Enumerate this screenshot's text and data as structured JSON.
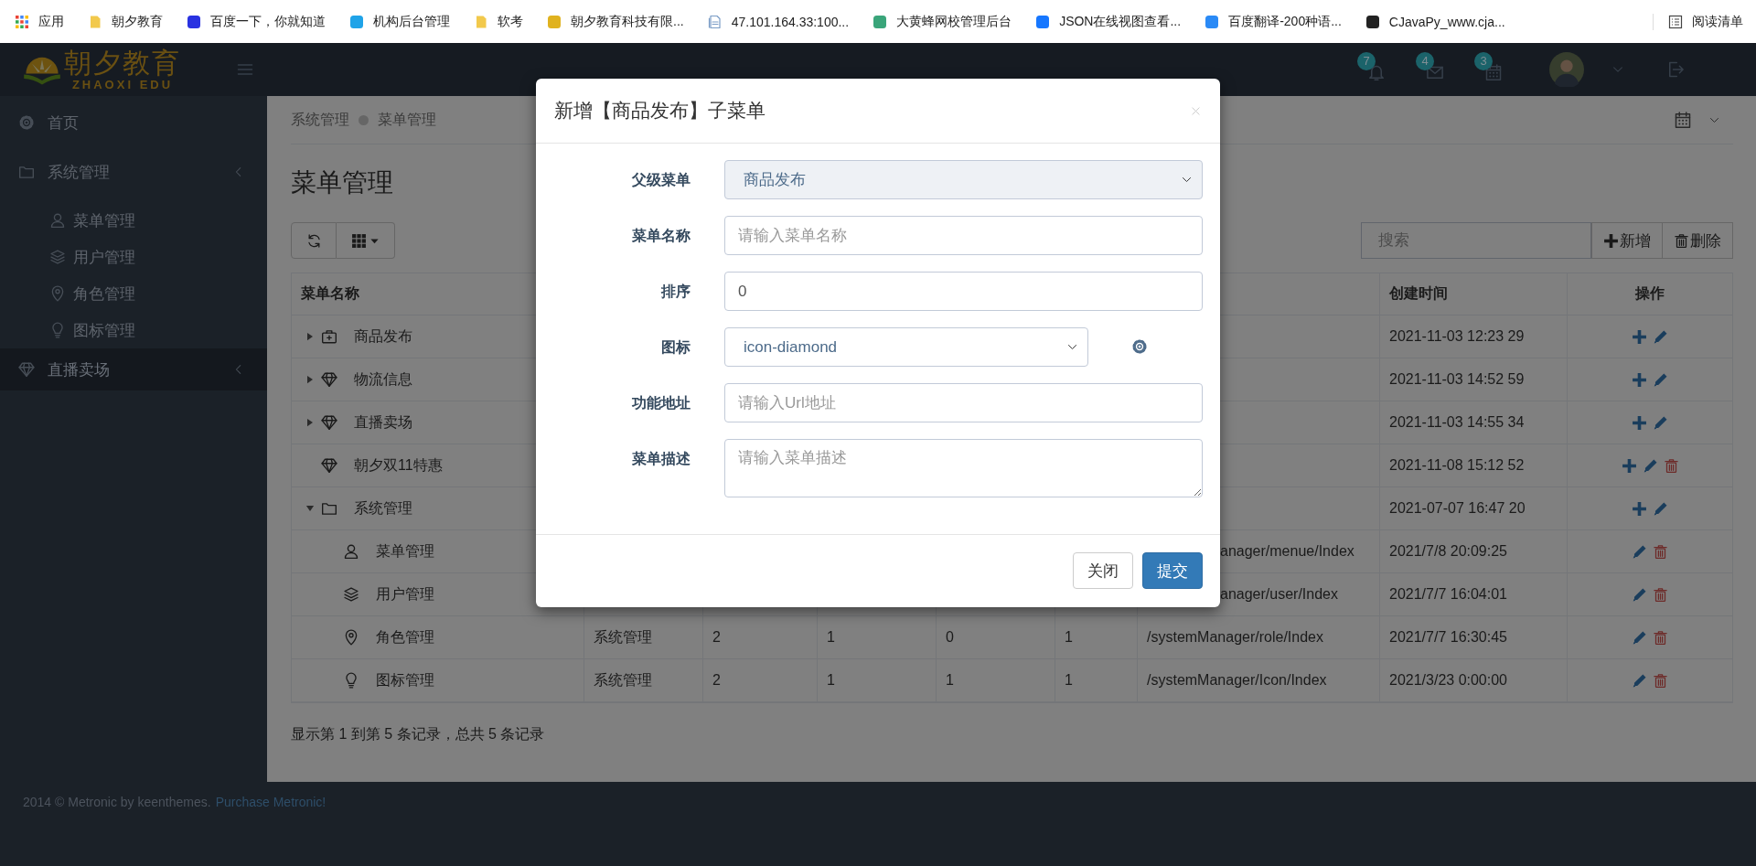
{
  "bookmarks": {
    "items": [
      {
        "kind": "apps",
        "label": "应用"
      },
      {
        "kind": "folder",
        "label": "朝夕教育"
      },
      {
        "kind": "site",
        "color": "#2932e1",
        "label": "百度一下，你就知道"
      },
      {
        "kind": "site",
        "color": "#1fa3e8",
        "label": "机构后台管理"
      },
      {
        "kind": "folder",
        "label": "软考"
      },
      {
        "kind": "site",
        "color": "#e0b21f",
        "label": "朝夕教育科技有限..."
      },
      {
        "kind": "page",
        "label": "47.101.164.33:100..."
      },
      {
        "kind": "site",
        "color": "#3aa57a",
        "label": "大黄蜂网校管理后台"
      },
      {
        "kind": "site",
        "color": "#1677ff",
        "label": "JSON在线视图查看..."
      },
      {
        "kind": "site",
        "color": "#2a8af6",
        "label": "百度翻译-200种语..."
      },
      {
        "kind": "site",
        "color": "#222222",
        "label": "CJavaPy_www.cja..."
      }
    ],
    "reading_list": "阅读清单"
  },
  "header": {
    "logo": {
      "name": "朝夕教育",
      "subtitle": "ZHAOXI EDU"
    },
    "notifications": [
      {
        "kind": "bell",
        "count": "7"
      },
      {
        "kind": "envelope",
        "count": "4"
      },
      {
        "kind": "calendar",
        "count": "3"
      }
    ]
  },
  "sidebar": {
    "items": [
      {
        "kind": "gear",
        "label": "首页",
        "selected": false
      },
      {
        "kind": "folder",
        "label": "系统管理",
        "selected": false,
        "submenu": true,
        "children": [
          {
            "kind": "user",
            "label": "菜单管理",
            "selected": false
          },
          {
            "kind": "layers",
            "label": "用户管理",
            "selected": false
          },
          {
            "kind": "pin",
            "label": "角色管理",
            "selected": false
          },
          {
            "kind": "bulb",
            "label": "图标管理",
            "selected": false
          }
        ]
      },
      {
        "kind": "diamond",
        "label": "直播卖场",
        "selected": true,
        "submenu": true
      }
    ]
  },
  "breadcrumb": [
    "系统管理",
    "菜单管理"
  ],
  "page_title": "菜单管理",
  "toolbar": {
    "search_placeholder": "搜索",
    "buttons": [
      {
        "kind": "add",
        "label": "新增"
      },
      {
        "kind": "delete",
        "label": "删除"
      }
    ]
  },
  "table": {
    "columns": [
      "菜单名称",
      "创建时间",
      "操作"
    ],
    "rows": [
      {
        "kind": "briefcase",
        "name": "商品发布",
        "expanded": false,
        "created": "2021-11-03 12:23 29",
        "actions": [
          {
            "kind": "add"
          },
          {
            "kind": "edit"
          }
        ]
      },
      {
        "kind": "diamond",
        "name": "物流信息",
        "expanded": false,
        "created": "2021-11-03 14:52 59",
        "actions": [
          {
            "kind": "add"
          },
          {
            "kind": "edit"
          }
        ]
      },
      {
        "kind": "diamond",
        "name": "直播卖场",
        "expanded": false,
        "created": "2021-11-03 14:55 34",
        "actions": [
          {
            "kind": "add"
          },
          {
            "kind": "edit"
          }
        ]
      },
      {
        "kind": "diamond",
        "name": "朝夕双11特惠",
        "created": "2021-11-08 15:12 52",
        "actions": [
          {
            "kind": "add"
          },
          {
            "kind": "edit"
          },
          {
            "kind": "delete"
          }
        ]
      },
      {
        "kind": "folder",
        "name": "系统管理",
        "expanded": true,
        "created": "2021-07-07 16:47 20",
        "actions": [
          {
            "kind": "add"
          },
          {
            "kind": "edit"
          }
        ],
        "children": [
          {
            "kind": "user",
            "name": "菜单管理",
            "column_7": "anager/menue/Index",
            "created": "2021/7/8 20:09:25",
            "actions": [
              {
                "kind": "edit"
              },
              {
                "kind": "delete"
              }
            ]
          },
          {
            "kind": "layers",
            "name": "用户管理",
            "column_7": "anager/user/Index",
            "created": "2021/7/7 16:04:01",
            "actions": [
              {
                "kind": "edit"
              },
              {
                "kind": "delete"
              }
            ]
          },
          {
            "kind": "pin",
            "name": "角色管理",
            "column_2": "系统管理",
            "column_3": "2",
            "column_4": "1",
            "column_5": "0",
            "column_6": "1",
            "column_7": "/systemManager/role/Index",
            "created": "2021/7/7 16:30:45",
            "actions": [
              {
                "kind": "edit"
              },
              {
                "kind": "delete"
              }
            ]
          },
          {
            "kind": "bulb",
            "name": "图标管理",
            "column_2": "系统管理",
            "column_3": "2",
            "column_4": "1",
            "column_5": "1",
            "column_6": "1",
            "column_7": "/systemManager/Icon/Index",
            "created": "2021/3/23 0:00:00",
            "actions": [
              {
                "kind": "edit"
              },
              {
                "kind": "delete"
              }
            ]
          }
        ]
      }
    ]
  },
  "table_footer": "显示第 1 到第 5 条记录，总共 5 条记录",
  "page_footer": {
    "text": "2014 © Metronic by keenthemes.",
    "link": "Purchase Metronic!"
  },
  "modal": {
    "title": "新增【商品发布】子菜单",
    "fields": [
      {
        "kind": "select",
        "label": "父级菜单",
        "value": "商品发布",
        "disabled": true
      },
      {
        "kind": "input",
        "label": "菜单名称",
        "placeholder": "请输入菜单名称"
      },
      {
        "kind": "input",
        "label": "排序",
        "value": "0"
      },
      {
        "kind": "select",
        "label": "图标",
        "value": "icon-diamond",
        "disabled": false,
        "picker": true
      },
      {
        "kind": "input",
        "label": "功能地址",
        "placeholder": "请输入Url地址"
      },
      {
        "kind": "textarea",
        "label": "菜单描述",
        "placeholder": "请输入菜单描述"
      }
    ],
    "buttons": [
      {
        "label": "关闭",
        "primary": false
      },
      {
        "label": "提交",
        "primary": true
      }
    ]
  }
}
